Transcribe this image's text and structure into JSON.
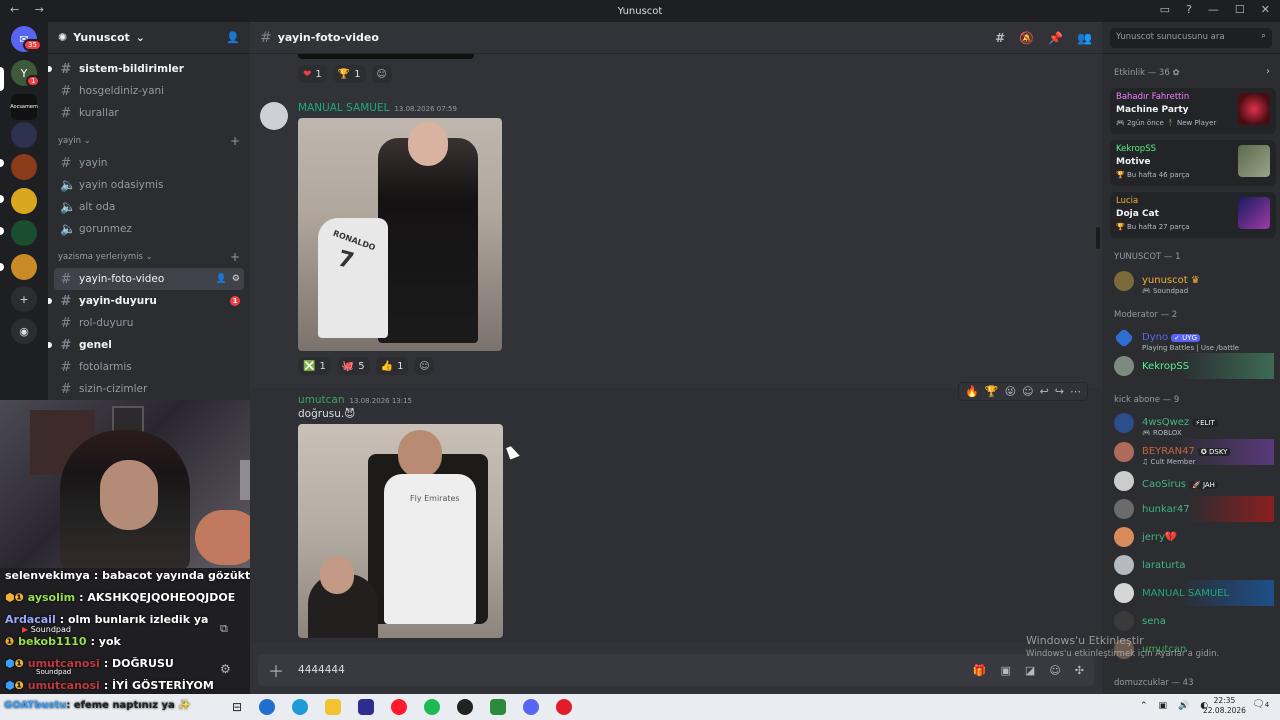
{
  "window": {
    "title": "Yunuscot",
    "nav": "← →"
  },
  "servers": {
    "badge_top": "35",
    "badge_second": "1",
    "label_second": "Aocsamem"
  },
  "guild": {
    "name": "Yunuscot"
  },
  "channels": {
    "top": [
      {
        "label": "sistem-bildirimler",
        "unread": true
      },
      {
        "label": "hosgeldiniz-yani",
        "unread": false
      },
      {
        "label": "kurallar",
        "unread": false
      }
    ],
    "cat1": "yayin",
    "cat1_items": [
      {
        "label": "yayin",
        "type": "text"
      },
      {
        "label": "yayin odasiymis",
        "type": "voice"
      },
      {
        "label": "alt oda",
        "type": "voice"
      },
      {
        "label": "gorunmez",
        "type": "voice"
      }
    ],
    "cat2": "yazisma yerleriymis",
    "cat2_items": [
      {
        "label": "yayin-foto-video",
        "active": true
      },
      {
        "label": "yayin-duyuru",
        "unread": true,
        "mentions": "1"
      },
      {
        "label": "rol-duyuru"
      },
      {
        "label": "genel",
        "unread": true
      },
      {
        "label": "fotolarmis"
      },
      {
        "label": "sizin-cizimler"
      }
    ]
  },
  "stream_chat": [
    {
      "user": "selenvekimya",
      "text": ": babacot yayında gözüktü mü hiç",
      "color": "#ffffff"
    },
    {
      "user": "aysolim",
      "text": ": AKSHKQEJQOHEOQJDOE",
      "color": "#9adf4b"
    },
    {
      "user": "Ardacail",
      "text": ": olm bunlarık izledik ya",
      "color": "#9aa8ff"
    },
    {
      "user": "bekob1110",
      "text": ": yok",
      "color": "#9adf4b"
    },
    {
      "user": "umutcanosi",
      "text": ": DOĞRUSU",
      "color": "#c0383d"
    },
    {
      "user": "umutcanosi",
      "text": ": İYİ GÖSTERİYOM",
      "color": "#c0383d"
    },
    {
      "user": "GOATbustu",
      "text": ": efeme naptınız ya",
      "color": "#3aa0ff"
    }
  ],
  "stream_overlay": {
    "soundpad1": "Soundpad",
    "soundpad2": "Soundpad"
  },
  "channel_header": {
    "name": "yayin-foto-video"
  },
  "messages": {
    "reactions_top": [
      {
        "emoji": "❤",
        "count": "1"
      },
      {
        "emoji": "🏆",
        "count": "1"
      }
    ],
    "m1": {
      "author": "MANUAL SAMUEL",
      "time": "13.08.2026 07:59",
      "author_color": "#1fa97a"
    },
    "reactions_m1": [
      {
        "emoji": "❎",
        "count": "1"
      },
      {
        "emoji": "🐙",
        "count": "5"
      },
      {
        "emoji": "👍",
        "count": "1"
      }
    ],
    "m2": {
      "author": "umutcan",
      "time": "13.08.2026 13:15",
      "text": "doğrusu.😈",
      "author_color": "#3ba55c"
    }
  },
  "composer": {
    "value": "4444444"
  },
  "members": {
    "search_placeholder": "Yunuscot sunucusunu ara",
    "events_header": "Etkinlik — 36 ✿",
    "events": [
      {
        "host": "Bahadır Fahrettin",
        "host_color": "#f47fff",
        "title": "Machine Party",
        "sub": "🎮 2gün önce  🕴 New Player"
      },
      {
        "host": "KekropSS",
        "host_color": "#57f287",
        "title": "Motive",
        "sub": "🏆 Bu hafta 46 parça"
      },
      {
        "host": "Lucia",
        "host_color": "#f0b232",
        "title": "Doja Cat",
        "sub": "🏆 Bu hafta 27 parça"
      }
    ],
    "owner_header": "YUNUSCOT — 1",
    "owner": {
      "name": "yunuscot ♛",
      "status": "🎮 Soundpad",
      "color": "#f0b232"
    },
    "mod_header": "Moderator — 2",
    "mods": [
      {
        "name": "Dyno",
        "tag": "✓ UYG",
        "status": "Playing Battles | Use /battle",
        "color": "#5865f2"
      },
      {
        "name": "KekropSS",
        "tag": "",
        "status": "",
        "color": "#57f287"
      }
    ],
    "kick_header": "kick abone — 9",
    "kick": [
      {
        "name": "4wsQwez",
        "tag": "⚡ELIT",
        "status": "🎮 ROBLOX",
        "color": "#43b581"
      },
      {
        "name": "BEYRAN47",
        "tag": "✪ DSKY",
        "status": "♫ Cult Member",
        "color": "#c4643c"
      },
      {
        "name": "CaoSirus",
        "tag": "🚀 JAH",
        "status": "",
        "color": "#43b581"
      },
      {
        "name": "hunkar47",
        "tag": "",
        "status": "",
        "color": "#43b581"
      },
      {
        "name": "jerry💔",
        "tag": "",
        "status": "",
        "color": "#43b581"
      },
      {
        "name": "laraturta",
        "tag": "",
        "status": "",
        "color": "#43b581"
      },
      {
        "name": "MANUAL SAMUEL",
        "tag": "",
        "status": "",
        "color": "#1fa97a"
      },
      {
        "name": "sena",
        "tag": "",
        "status": "",
        "color": "#43b581"
      },
      {
        "name": "umutcan",
        "tag": "",
        "status": "",
        "color": "#3ba55c"
      }
    ],
    "domuz_header": "domuzcuklar — 43"
  },
  "windows_watermark": {
    "line1": "Windows'u Etkinleştir",
    "line2": "Windows'u etkinleştirmek için Ayarlar'a gidin."
  },
  "taskbar": {
    "time": "22:35",
    "date": "22.08.2026",
    "notif": "4"
  }
}
